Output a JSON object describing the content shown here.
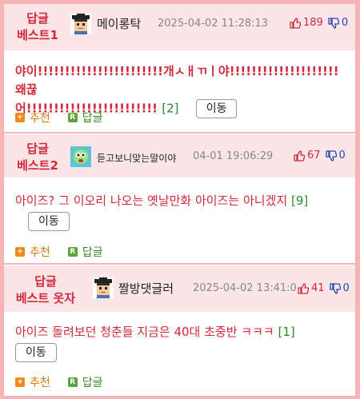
{
  "colors": {
    "accent": "#d1283b",
    "header_bg": "#fbe5e7",
    "border": "#f7b3b6",
    "reply_green": "#2b8a2b",
    "down_blue": "#2346b8",
    "recommend_orange": "#e07b10"
  },
  "comments": [
    {
      "rank_line1": "답글",
      "rank_line2": "베스트1",
      "nickname": "메이롱탁",
      "time": "2025-04-02 11:28:13",
      "up": "189",
      "down": "0",
      "text_line1": "야이!!!!!!!!!!!!!!!!!!!!!!!개ㅅㅐㄲㅣ야!!!!!!!!!!!!!!!!!!!! 왜끊",
      "text_line2": "어!!!!!!!!!!!!!!!!!!!!!!!!",
      "reply_count": "[2]",
      "move_label": "이동",
      "recommend_label": "추천",
      "reply_label": "답글"
    },
    {
      "rank_line1": "답글",
      "rank_line2": "베스트2",
      "nickname": "듣고보니맞는말이야",
      "time": "04-01 19:06:29",
      "up": "67",
      "down": "0",
      "text_line1": "아이즈? 그 이오리 나오는 옛날만화 아이즈는 아니겠지",
      "reply_count": "[9]",
      "move_label": "이동",
      "recommend_label": "추천",
      "reply_label": "답글"
    },
    {
      "rank_line1": "답글",
      "rank_line2": "베스트 옷자",
      "nickname": "짤방댓글러",
      "time": "2025-04-02 13:41:0",
      "up": "41",
      "down": "0",
      "text_line1": "아이즈 돌려보던 청춘들 지금은 40대 초중반 ㅋㅋㅋ",
      "reply_count": "[1]",
      "move_label": "이동",
      "recommend_label": "추천",
      "reply_label": "답글"
    }
  ],
  "icons": {
    "thumb_up": "thumbs-up-icon",
    "thumb_down": "thumbs-down-icon",
    "plus": "plus-icon",
    "reply": "reply-icon"
  }
}
